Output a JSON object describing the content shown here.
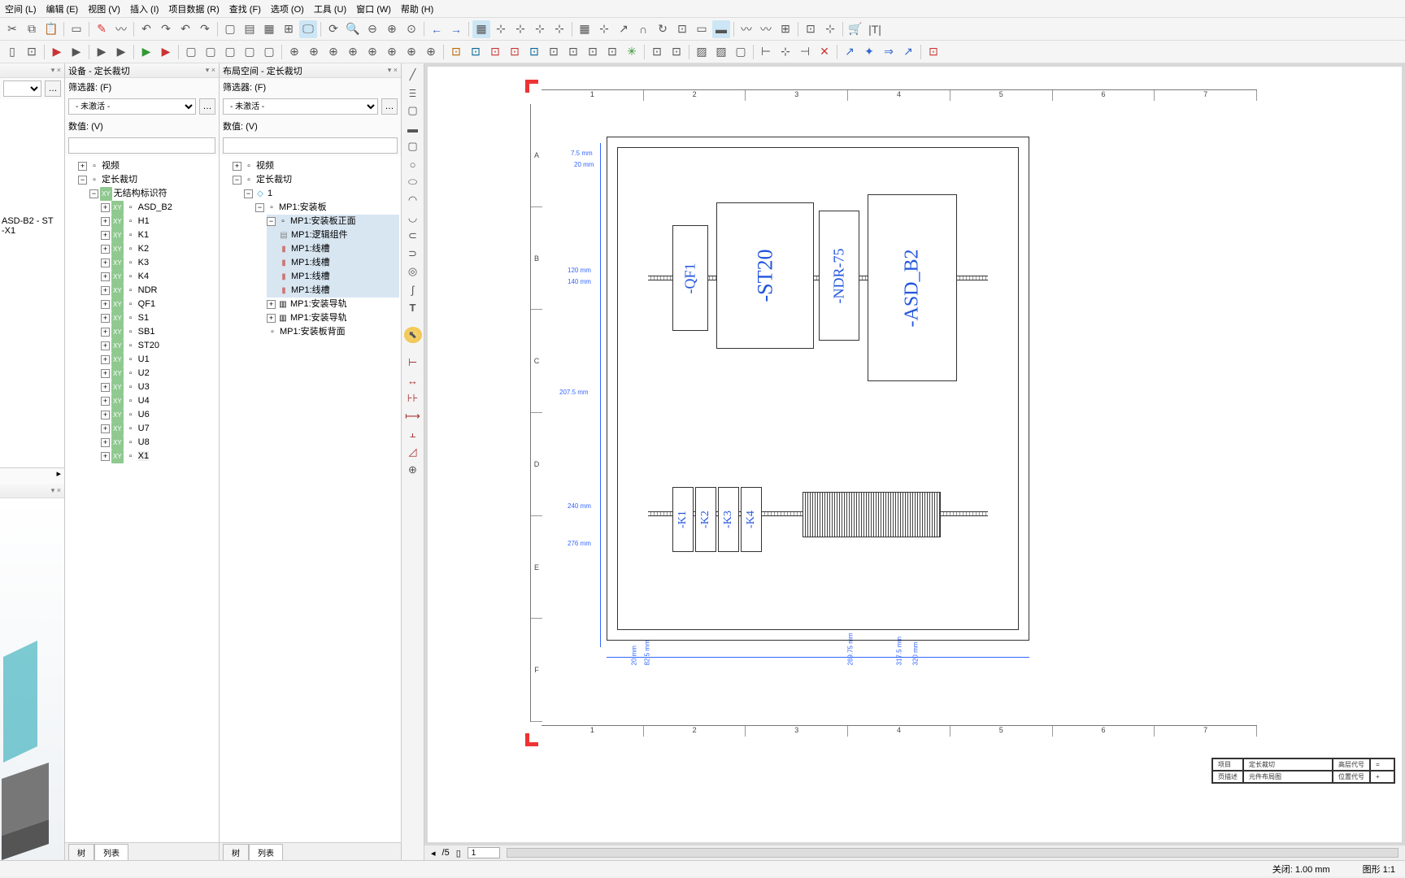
{
  "menu": [
    "空间 (L)",
    "编辑 (E)",
    "视图 (V)",
    "插入 (I)",
    "项目数据 (R)",
    "查找 (F)",
    "选项 (O)",
    "工具 (U)",
    "窗口 (W)",
    "帮助 (H)"
  ],
  "panels": {
    "p0": {
      "title": "",
      "crumb": "ASD-B2 - ST",
      "crumb2": "-X1"
    },
    "p1": {
      "title": "设备 - 定长裁切",
      "filter_label": "筛选器: (F)",
      "activate": "- 未激活 -",
      "value_label": "数值: (V)"
    },
    "p2": {
      "title": "布局空间 - 定长裁切",
      "filter_label": "筛选器: (F)",
      "activate": "- 未激活 -",
      "value_label": "数值: (V)"
    }
  },
  "tree1": {
    "root1": "视频",
    "root2": "定长裁切",
    "sub": "无结构标识符",
    "items": [
      "ASD_B2",
      "H1",
      "K1",
      "K2",
      "K3",
      "K4",
      "NDR",
      "QF1",
      "S1",
      "SB1",
      "ST20",
      "U1",
      "U2",
      "U3",
      "U4",
      "U6",
      "U7",
      "U8",
      "X1"
    ]
  },
  "tree2": {
    "root1": "视频",
    "root2": "定长裁切",
    "n1": "1",
    "mp_board": "MP1:安装板",
    "mp_front": "MP1:安装板正面",
    "mp_logic": "MP1:逻辑组件",
    "mp_slot": "MP1:线槽",
    "mp_rail": "MP1:安装导轨",
    "mp_back": "MP1:安装板背面"
  },
  "tabs": {
    "tree": "树",
    "list": "列表"
  },
  "drawing": {
    "cols": [
      "1",
      "2",
      "3",
      "4",
      "5",
      "6",
      "7"
    ],
    "rows": [
      "A",
      "B",
      "C",
      "D",
      "E",
      "F"
    ],
    "dims": {
      "d75": "7.5 mm",
      "d20": "20 mm",
      "d120": "120 mm",
      "d140": "140 mm",
      "d2075": "207.5 mm",
      "d240": "240 mm",
      "d276": "276 mm",
      "bx20": "20 mm",
      "bx825": "82.5 mm",
      "bx26975": "269.75 mm",
      "bx3175": "317.5 mm",
      "bx320": "320 mm"
    },
    "comps": {
      "qf1": "-QF1",
      "st20": "-ST20",
      "ndr": "-NDR-75",
      "asd": "-ASD_B2",
      "k1": "-K1",
      "k2": "-K2",
      "k3": "-K3",
      "k4": "-K4"
    },
    "tb": {
      "l1a": "项目",
      "l1b": "定长裁切",
      "l1c": "高层代号",
      "l1d": "=",
      "l2a": "页描述",
      "l2b": "元件布局图",
      "l2c": "位置代号",
      "l2d": "+"
    }
  },
  "paging": {
    "total": "/5",
    "page": "1"
  },
  "status": {
    "snap": "关闭: 1.00 mm",
    "scale": "图形 1:1"
  }
}
